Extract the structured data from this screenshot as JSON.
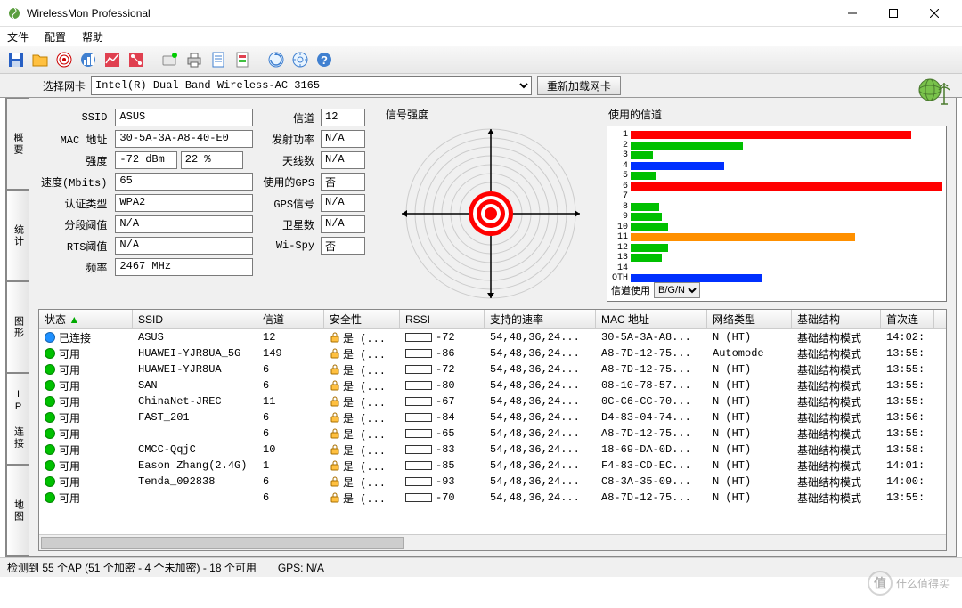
{
  "window": {
    "title": "WirelessMon Professional"
  },
  "menu": {
    "file": "文件",
    "config": "配置",
    "help": "帮助"
  },
  "adapter": {
    "label": "选择网卡",
    "value": "Intel(R) Dual Band Wireless-AC 3165",
    "reload": "重新加载网卡"
  },
  "tabs": [
    "概要",
    "统计",
    "图形",
    "IP 连接",
    "地图"
  ],
  "info": {
    "ssid_label": "SSID",
    "ssid": "ASUS",
    "channel_label": "信道",
    "channel": "12",
    "mac_label": "MAC 地址",
    "mac": "30-5A-3A-A8-40-E0",
    "txpower_label": "发射功率",
    "txpower": "N/A",
    "strength_label": "强度",
    "strength_dbm": "-72 dBm",
    "strength_pct": "22 %",
    "antennas_label": "天线数",
    "antennas": "N/A",
    "speed_label": "速度(Mbits)",
    "speed": "65",
    "gps_used_label": "使用的GPS",
    "gps_used": "否",
    "auth_label": "认证类型",
    "auth": "WPA2",
    "gps_signal_label": "GPS信号",
    "gps_signal": "N/A",
    "frag_label": "分段阈值",
    "frag": "N/A",
    "satellites_label": "卫星数",
    "satellites": "N/A",
    "rts_label": "RTS阈值",
    "rts": "N/A",
    "wispy_label": "Wi-Spy",
    "wispy": "否",
    "freq_label": "频率",
    "freq": "2467 MHz"
  },
  "signal_panel_label": "信号强度",
  "channel_panel_label": "使用的信道",
  "chart_data": {
    "type": "bar",
    "title": "使用的信道",
    "xlabel": "",
    "ylabel": "信道",
    "categories": [
      "1",
      "2",
      "3",
      "4",
      "5",
      "6",
      "7",
      "8",
      "9",
      "10",
      "11",
      "12",
      "13",
      "14",
      "OTH"
    ],
    "values": [
      90,
      36,
      7,
      30,
      8,
      100,
      0,
      9,
      10,
      12,
      72,
      12,
      10,
      0,
      42
    ],
    "colors": [
      "#ff0000",
      "#00c000",
      "#00c000",
      "#0030ff",
      "#00c000",
      "#ff0000",
      "#ffffff",
      "#00c000",
      "#00c000",
      "#00c000",
      "#ff9000",
      "#00c000",
      "#00c000",
      "#ffffff",
      "#0030ff"
    ],
    "select_label": "信道使用",
    "select_value": "B/G/N"
  },
  "columns": {
    "status": "状态",
    "ssid": "SSID",
    "channel": "信道",
    "security": "安全性",
    "rssi": "RSSI",
    "rates": "支持的速率",
    "mac": "MAC 地址",
    "type": "网络类型",
    "infra": "基础结构",
    "first": "首次连"
  },
  "security_text": "是 (...",
  "networks": [
    {
      "status": "已连接",
      "dot": "#1e90ff",
      "ssid": "ASUS",
      "ch": "12",
      "rssi": -72,
      "rates": "54,48,36,24...",
      "mac": "30-5A-3A-A8...",
      "type": "N (HT)",
      "infra": "基础结构模式",
      "first": "14:02:"
    },
    {
      "status": "可用",
      "dot": "#00c000",
      "ssid": "HUAWEI-YJR8UA_5G",
      "ch": "149",
      "rssi": -86,
      "rates": "54,48,36,24...",
      "mac": "A8-7D-12-75...",
      "type": "Automode",
      "infra": "基础结构模式",
      "first": "13:55:"
    },
    {
      "status": "可用",
      "dot": "#00c000",
      "ssid": "HUAWEI-YJR8UA",
      "ch": "6",
      "rssi": -72,
      "rates": "54,48,36,24...",
      "mac": "A8-7D-12-75...",
      "type": "N (HT)",
      "infra": "基础结构模式",
      "first": "13:55:"
    },
    {
      "status": "可用",
      "dot": "#00c000",
      "ssid": "SAN",
      "ch": "6",
      "rssi": -80,
      "rates": "54,48,36,24...",
      "mac": "08-10-78-57...",
      "type": "N (HT)",
      "infra": "基础结构模式",
      "first": "13:55:"
    },
    {
      "status": "可用",
      "dot": "#00c000",
      "ssid": "ChinaNet-JREC",
      "ch": "11",
      "rssi": -67,
      "rates": "54,48,36,24...",
      "mac": "0C-C6-CC-70...",
      "type": "N (HT)",
      "infra": "基础结构模式",
      "first": "13:55:"
    },
    {
      "status": "可用",
      "dot": "#00c000",
      "ssid": "FAST_201",
      "ch": "6",
      "rssi": -84,
      "rates": "54,48,36,24...",
      "mac": "D4-83-04-74...",
      "type": "N (HT)",
      "infra": "基础结构模式",
      "first": "13:56:"
    },
    {
      "status": "可用",
      "dot": "#00c000",
      "ssid": "",
      "ch": "6",
      "rssi": -65,
      "rates": "54,48,36,24...",
      "mac": "A8-7D-12-75...",
      "type": "N (HT)",
      "infra": "基础结构模式",
      "first": "13:55:"
    },
    {
      "status": "可用",
      "dot": "#00c000",
      "ssid": "CMCC-QqjC",
      "ch": "10",
      "rssi": -83,
      "rates": "54,48,36,24...",
      "mac": "18-69-DA-0D...",
      "type": "N (HT)",
      "infra": "基础结构模式",
      "first": "13:58:"
    },
    {
      "status": "可用",
      "dot": "#00c000",
      "ssid": "Eason Zhang(2.4G)",
      "ch": "1",
      "rssi": -85,
      "rates": "54,48,36,24...",
      "mac": "F4-83-CD-EC...",
      "type": "N (HT)",
      "infra": "基础结构模式",
      "first": "14:01:"
    },
    {
      "status": "可用",
      "dot": "#00c000",
      "ssid": "Tenda_092838",
      "ch": "6",
      "rssi": -93,
      "rates": "54,48,36,24...",
      "mac": "C8-3A-35-09...",
      "type": "N (HT)",
      "infra": "基础结构模式",
      "first": "14:00:"
    },
    {
      "status": "可用",
      "dot": "#00c000",
      "ssid": "",
      "ch": "6",
      "rssi": -70,
      "rates": "54,48,36,24...",
      "mac": "A8-7D-12-75...",
      "type": "N (HT)",
      "infra": "基础结构模式",
      "first": "13:55:"
    }
  ],
  "statusbar": {
    "aps": "检测到 55 个AP (51 个加密 - 4 个未加密) - 18 个可用",
    "gps": "GPS: N/A"
  },
  "watermark": "什么值得买"
}
